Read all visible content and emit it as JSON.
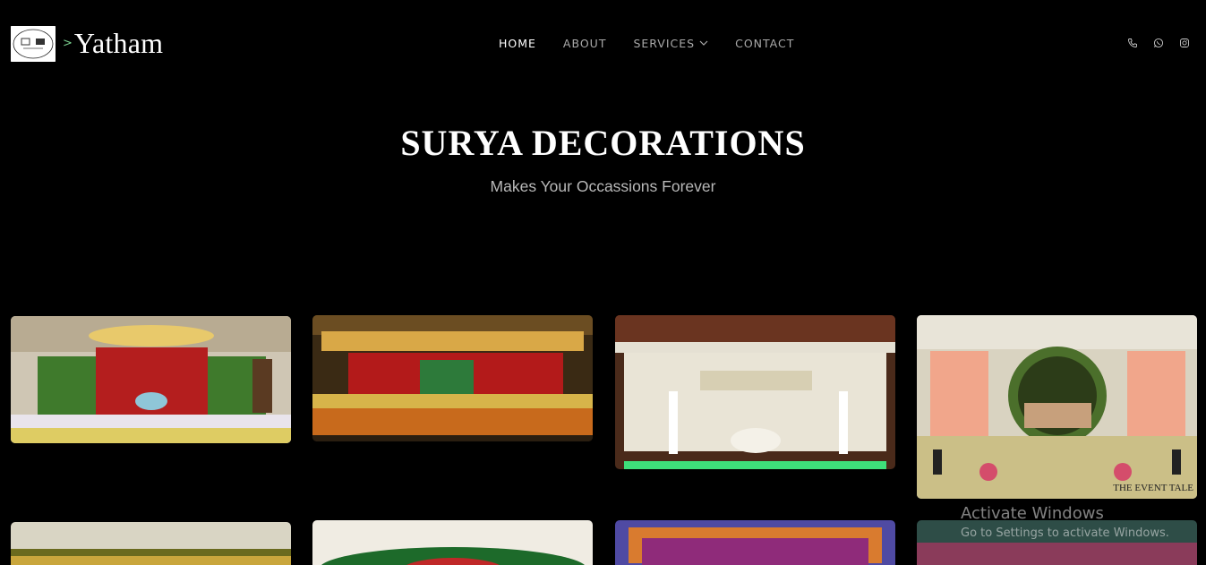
{
  "brand": {
    "prefix": ">",
    "name": "Yatham"
  },
  "nav": {
    "items": [
      {
        "label": "HOME",
        "active": true
      },
      {
        "label": "ABOUT"
      },
      {
        "label": "SERVICES"
      },
      {
        "label": "CONTACT"
      }
    ]
  },
  "social": [
    "phone-icon",
    "whatsapp-icon",
    "instagram-icon"
  ],
  "hero": {
    "title": "SURYA DECORATIONS",
    "subtitle": "Makes Your Occassions Forever"
  },
  "gallery": {
    "tile4_caption": "THE EVENT TALE"
  },
  "watermark": {
    "line1": "Activate Windows",
    "line2": "Go to Settings to activate Windows."
  },
  "colors": {
    "background": "#000000",
    "nav_active": "#ffffff",
    "nav_inactive": "#a9a9a9",
    "subtitle": "#b9b9b9",
    "brand_chevron": "#7bd18f"
  }
}
